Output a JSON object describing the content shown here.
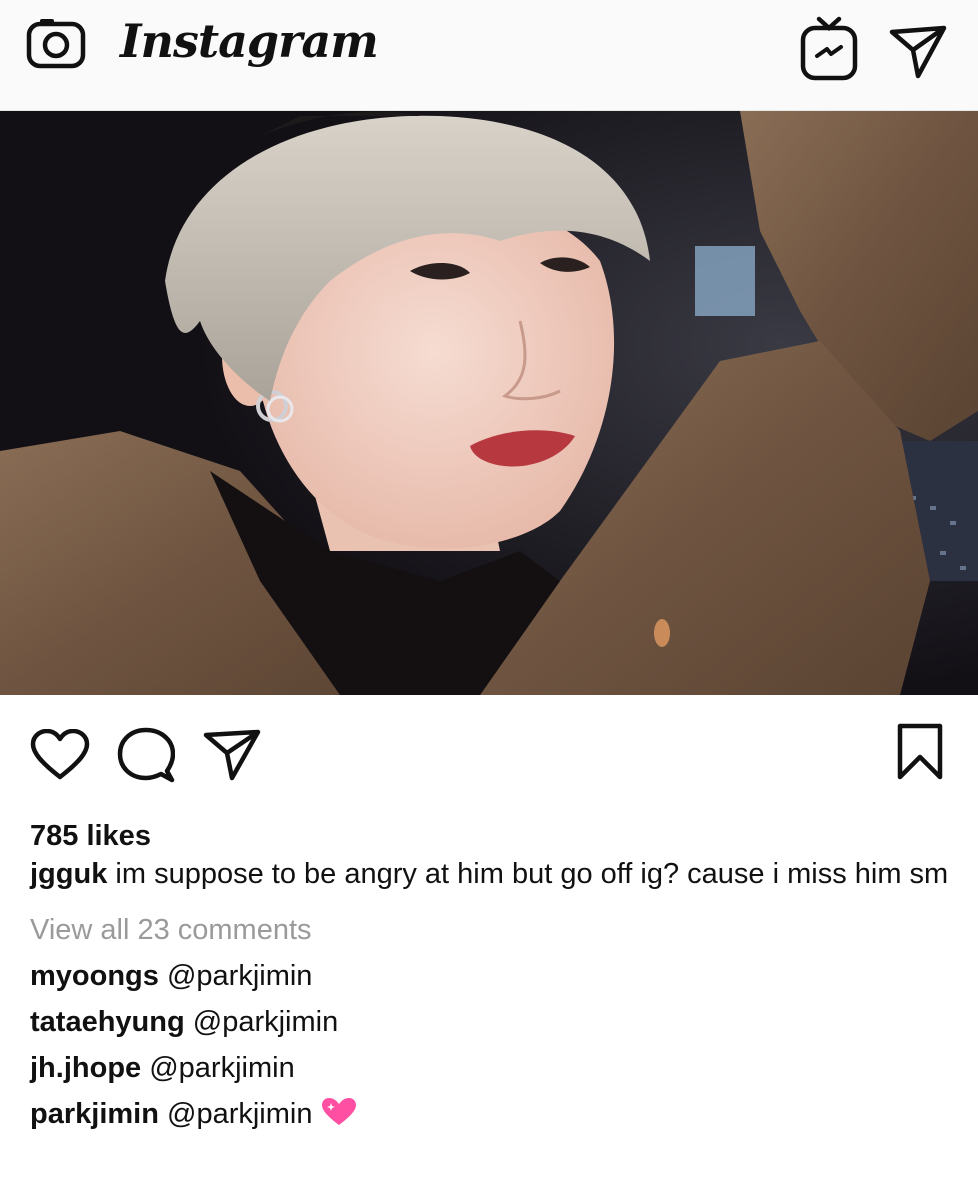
{
  "app": {
    "logo": "Instagram"
  },
  "header": {
    "icons": [
      "camera-icon",
      "igtv-icon",
      "direct-message-icon"
    ]
  },
  "post": {
    "likes": "785 likes",
    "caption": {
      "user": "jgguk",
      "text": "im suppose to be angry at him but go off ig? cause i miss him sm"
    },
    "view_all": "View all 23 comments",
    "comments": [
      {
        "user": "myoongs",
        "text": "@parkjimin"
      },
      {
        "user": "tataehyung",
        "text": "@parkjimin"
      },
      {
        "user": "jh.jhope",
        "text": "@parkjimin"
      },
      {
        "user": "parkjimin",
        "text": "@parkjimin",
        "emoji": "sparkling-heart-icon"
      }
    ]
  },
  "actions": {
    "icons": [
      "heart-icon",
      "comment-icon",
      "share-icon",
      "bookmark-icon"
    ]
  },
  "colors": {
    "header_bg": "#fafafa",
    "muted_text": "#9a9a9a",
    "emoji_pink": "#ff4fa3"
  }
}
